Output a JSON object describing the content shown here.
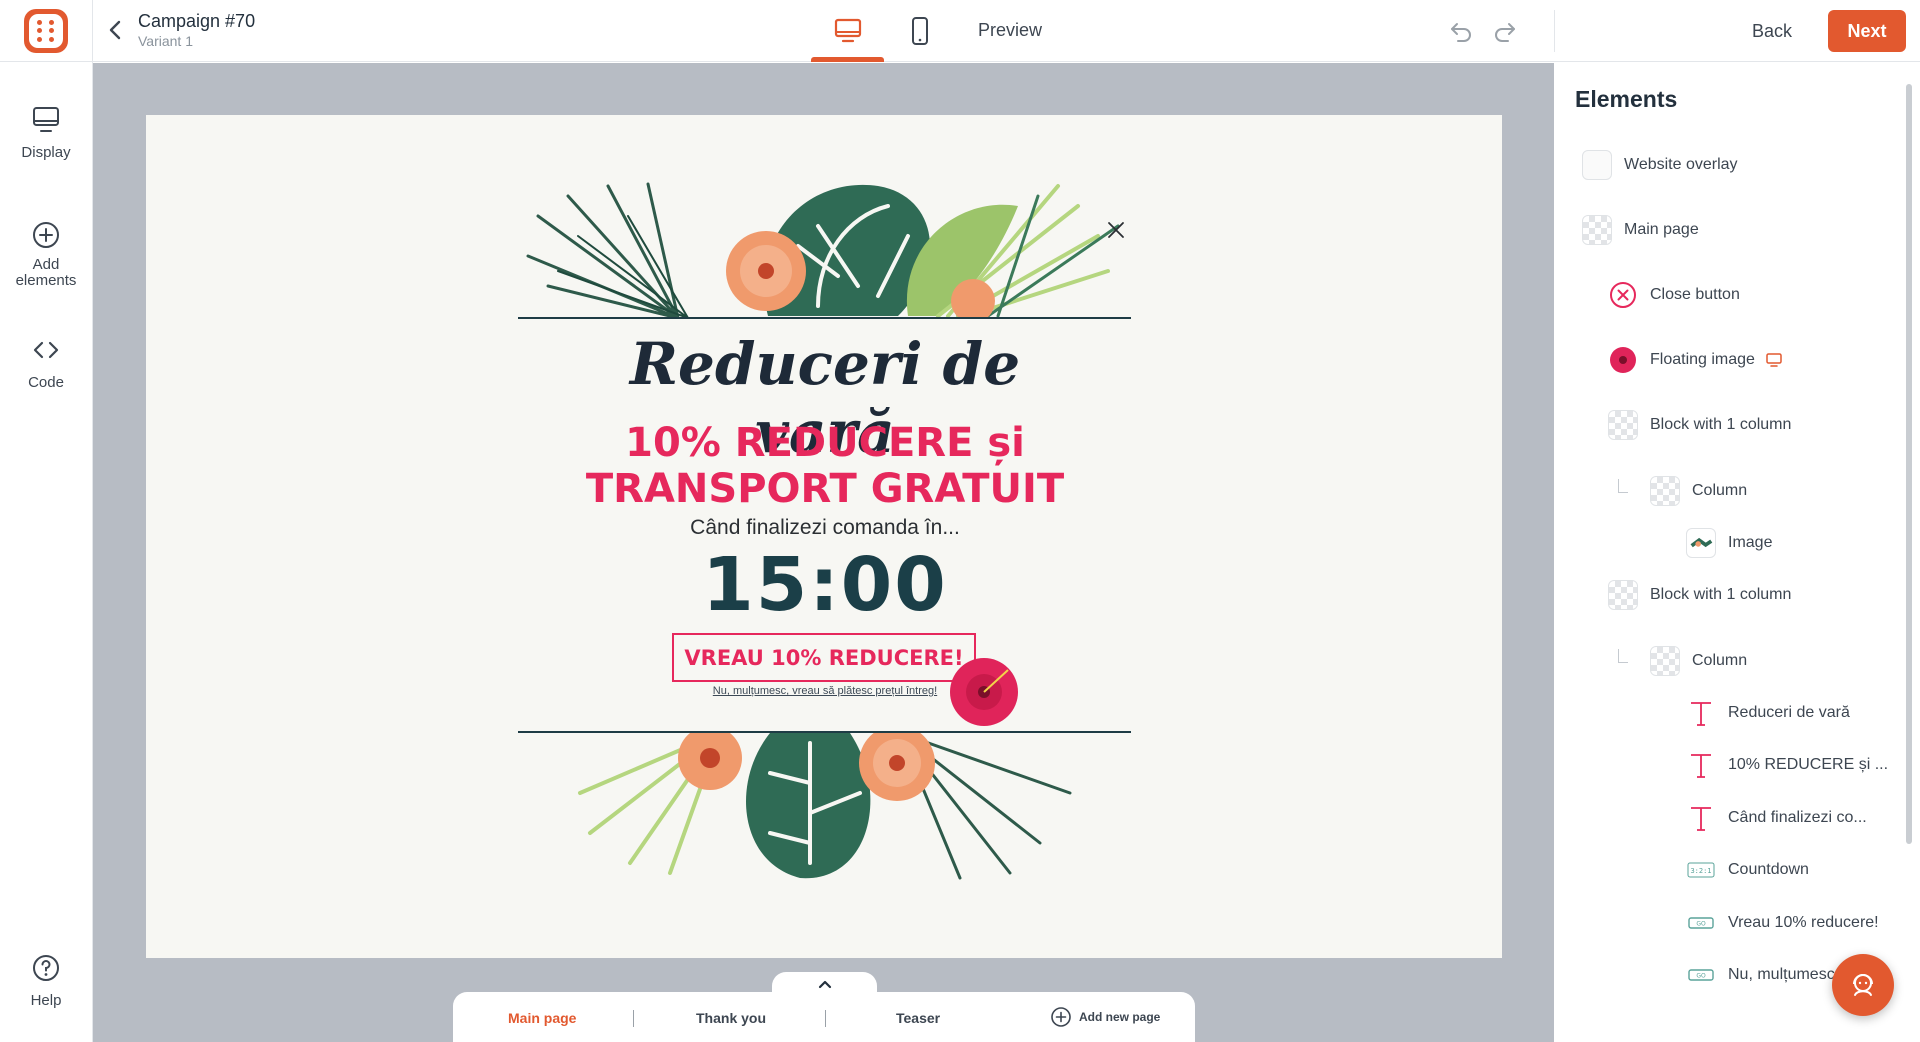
{
  "app": {
    "campaign_title": "Campaign #70",
    "variant": "Variant 1",
    "preview_label": "Preview",
    "back_label": "Back",
    "next_label": "Next",
    "brand_color": "#e2592f"
  },
  "sidebar": {
    "items": [
      {
        "label": "Display",
        "icon": "monitor-icon"
      },
      {
        "label": "Add elements",
        "icon": "plus-circle-icon"
      },
      {
        "label": "Code",
        "icon": "code-icon"
      }
    ],
    "help_label": "Help"
  },
  "popup": {
    "heading": "Reduceri de vară",
    "offer_line1": "10% REDUCERE și",
    "offer_line2": "TRANSPORT GRATUIT",
    "subtext": "Când finalizezi comanda în...",
    "countdown": "15:00",
    "cta": "VREAU 10% REDUCERE!",
    "decline": "Nu, mulțumesc, vreau să plătesc prețul întreg!",
    "accent_color": "#e6285c",
    "dark_color": "#1b3f48"
  },
  "pages": {
    "tabs": [
      "Main page",
      "Thank you",
      "Teaser"
    ],
    "active": "Main page",
    "add_label": "Add new page"
  },
  "elements_panel": {
    "title": "Elements",
    "items": [
      {
        "label": "Website overlay",
        "icon": "blank"
      },
      {
        "label": "Main page",
        "icon": "checker"
      },
      {
        "label": "Close button",
        "icon": "close-circle-icon"
      },
      {
        "label": "Floating image",
        "icon": "hibiscus-thumbnail",
        "badge": "desktop-icon"
      },
      {
        "label": "Block with 1 column",
        "icon": "checker"
      },
      {
        "label": "Column",
        "icon": "checker"
      },
      {
        "label": "Image",
        "icon": "leaf-thumbnail"
      },
      {
        "label": "Block with 1 column",
        "icon": "checker"
      },
      {
        "label": "Column",
        "icon": "checker"
      },
      {
        "label": "Reduceri de vară",
        "icon": "text-icon"
      },
      {
        "label": "10% REDUCERE și ...",
        "icon": "text-icon"
      },
      {
        "label": "Când finalizezi co...",
        "icon": "text-icon"
      },
      {
        "label": "Countdown",
        "icon": "countdown-icon"
      },
      {
        "label": "Vreau 10% reducere!",
        "icon": "button-icon"
      },
      {
        "label": "Nu, mulțumesc",
        "icon": "button-icon"
      }
    ]
  }
}
